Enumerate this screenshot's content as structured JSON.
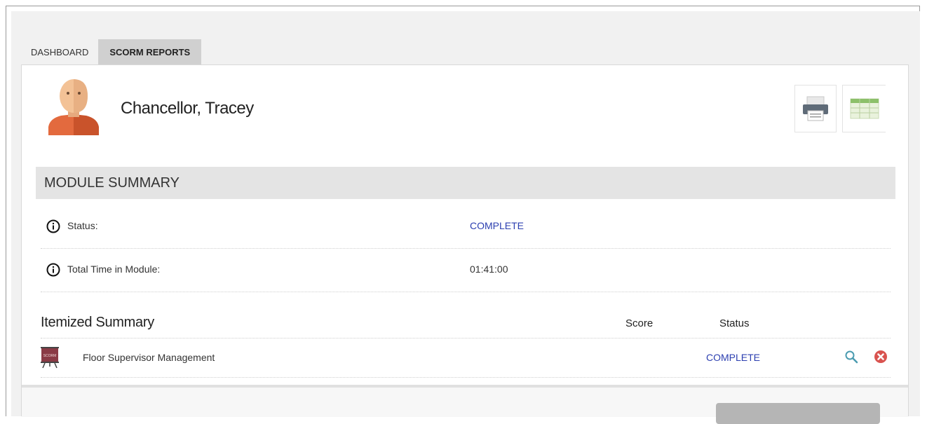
{
  "tabs": [
    {
      "label": "DASHBOARD",
      "active": false
    },
    {
      "label": "SCORM REPORTS",
      "active": true
    }
  ],
  "user": {
    "name": "Chancellor, Tracey"
  },
  "toolbar": {
    "print_icon": "printer-icon",
    "export_icon": "spreadsheet-icon"
  },
  "module_summary": {
    "title": "MODULE SUMMARY",
    "rows": [
      {
        "label": "Status:",
        "value": "COMPLETE"
      },
      {
        "label": "Total Time in Module:",
        "value": "01:41:00"
      }
    ]
  },
  "itemized": {
    "title": "Itemized Summary",
    "columns": {
      "score": "Score",
      "status": "Status"
    },
    "items": [
      {
        "name": "Floor Supervisor Management",
        "score": "",
        "status": "COMPLETE",
        "icon_text": "SCORM"
      }
    ]
  },
  "colors": {
    "link_blue": "#2c3fb0",
    "accent_teal": "#4a9bb0",
    "danger": "#d9534f",
    "section_gray": "#e4e4e4"
  }
}
